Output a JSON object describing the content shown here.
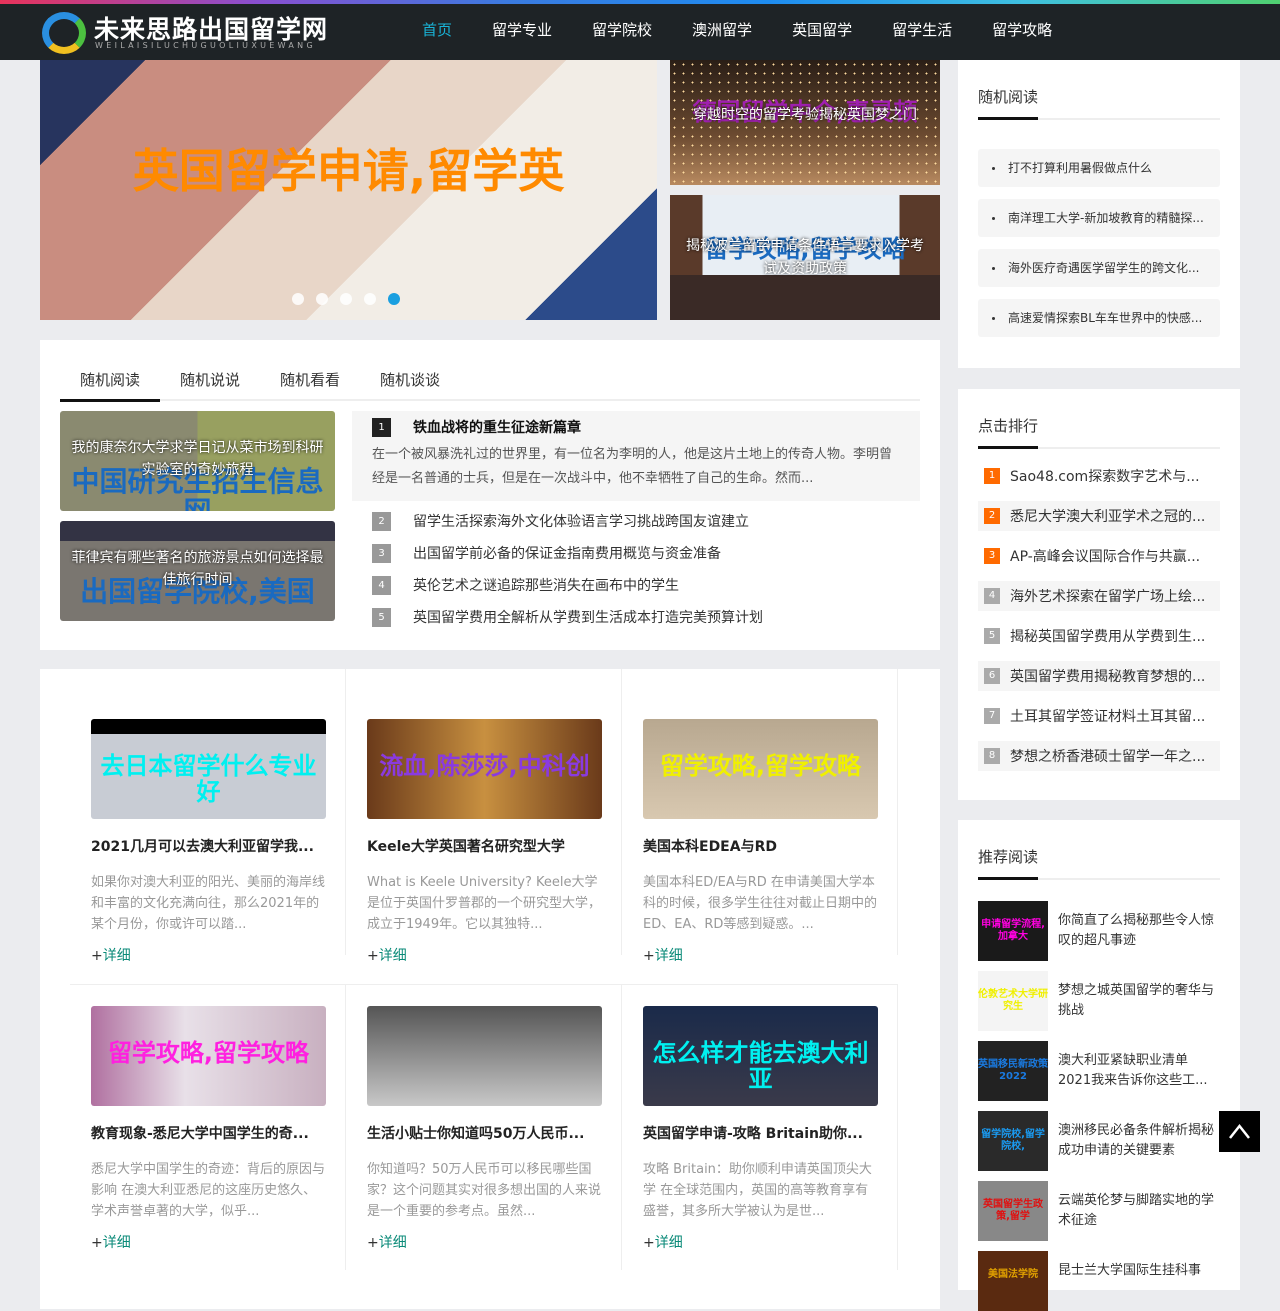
{
  "header": {
    "logo_title": "未来思路出国留学网",
    "logo_subtitle": "WEILAISILUCHUGUOLIUXUEWANG",
    "nav": [
      "首页",
      "留学专业",
      "留学院校",
      "澳洲留学",
      "英国留学",
      "留学生活",
      "留学攻略"
    ],
    "active_nav": "首页"
  },
  "slider": {
    "caption": "英国留学申请,留学英",
    "slide_count": 5,
    "active_slide": 5
  },
  "side_pics": [
    {
      "title": "穿越时空的留学考验揭秘英国梦之门",
      "overlay": "德国留学中介,惠灵顿"
    },
    {
      "title": "揭秘波兰留学申请条件语言要求入学考试及资助政策",
      "overlay": "留学攻略,留学攻略"
    }
  ],
  "tabs": {
    "items": [
      "随机阅读",
      "随机说说",
      "随机看看",
      "随机谈谈"
    ],
    "active": "随机阅读",
    "thumbs": [
      {
        "title": "我的康奈尔大学求学日记从菜市场到科研实验室的奇妙旅程",
        "overlay": "中国研究生招生信息网"
      },
      {
        "title": "菲律宾有哪些著名的旅游景点如何选择最佳旅行时间",
        "overlay": "出国留学院校,美国"
      }
    ],
    "list": [
      {
        "num": "1",
        "title": "铁血战将的重生征途新篇章",
        "desc": "在一个被风暴洗礼过的世界里，有一位名为李明的人，他是这片土地上的传奇人物。李明曾经是一名普通的士兵，但是在一次战斗中，他不幸牺牲了自己的生命。然而..."
      },
      {
        "num": "2",
        "title": "留学生活探索海外文化体验语言学习挑战跨国友谊建立"
      },
      {
        "num": "3",
        "title": "出国留学前必备的保证金指南费用概览与资金准备"
      },
      {
        "num": "4",
        "title": "英伦艺术之谜追踪那些消失在画布中的学生"
      },
      {
        "num": "5",
        "title": "英国留学费用全解析从学费到生活成本打造完美预算计划"
      }
    ]
  },
  "cards": {
    "more_label": "详细",
    "items": [
      {
        "title": "2021几月可以去澳大利亚留学我...",
        "desc": "如果你对澳大利亚的阳光、美丽的海岸线和丰富的文化充满向往，那么2021年的某个月份，你或许可以踏...",
        "overlay": "去日本留学什么专业好",
        "overlay_color": "#00f0f0"
      },
      {
        "title": "Keele大学英国著名研究型大学",
        "desc": "What is Keele University? Keele大学是位于英国什罗普郡的一个研究型大学，成立于1949年。它以其独特...",
        "overlay": "流血,陈莎莎,中科创",
        "overlay_color": "#8a3ae0"
      },
      {
        "title": "美国本科EDEA与RD",
        "desc": "美国本科ED/EA与RD 在申请美国大学本科的时候，很多学生往往对截止日期中的ED、EA、RD等感到疑惑。...",
        "overlay": "留学攻略,留学攻略",
        "overlay_color": "#f0f000"
      },
      {
        "title": "教育现象-悉尼大学中国学生的奇...",
        "desc": "悉尼大学中国学生的奇迹：背后的原因与影响 在澳大利亚悉尼的这座历史悠久、学术声誉卓著的大学，似乎...",
        "overlay": "留学攻略,留学攻略",
        "overlay_color": "#ff20e0"
      },
      {
        "title": "生活小贴士你知道吗50万人民币...",
        "desc": "你知道吗？50万人民币可以移民哪些国家？这个问题其实对很多想出国的人来说是一个重要的参考点。虽然...",
        "overlay": "",
        "overlay_color": "#ffffff"
      },
      {
        "title": "英国留学申请-攻略 Britain助你...",
        "desc": "攻略 Britain：助你顺利申请英国顶尖大学 在全球范围内，英国的高等教育享有盛誉，其多所大学被认为是世...",
        "overlay": "怎么样才能去澳大利亚",
        "overlay_color": "#00f0f0"
      }
    ]
  },
  "sidebar": {
    "random": {
      "title": "随机阅读",
      "items": [
        "打不打算利用暑假做点什么",
        "南洋理工大学-新加坡教育的精髓探...",
        "海外医疗奇遇医学留学生的跨文化...",
        "高速爱情探索BL车车世界中的快感..."
      ]
    },
    "ranking": {
      "title": "点击排行",
      "items": [
        {
          "num": "1",
          "title": "Sao48.com探索数字艺术与..."
        },
        {
          "num": "2",
          "title": "悉尼大学澳大利亚学术之冠的..."
        },
        {
          "num": "3",
          "title": "AP-高峰会议国际合作与共赢..."
        },
        {
          "num": "4",
          "title": "海外艺术探索在留学广场上绘..."
        },
        {
          "num": "5",
          "title": "揭秘英国留学费用从学费到生..."
        },
        {
          "num": "6",
          "title": "英国留学费用揭秘教育梦想的..."
        },
        {
          "num": "7",
          "title": "土耳其留学签证材料土耳其留..."
        },
        {
          "num": "8",
          "title": "梦想之桥香港硕士留学一年之..."
        }
      ]
    },
    "recommend": {
      "title": "推荐阅读",
      "items": [
        {
          "title": "你简直了么揭秘那些令人惊叹的超凡事迹",
          "overlay": "申请留学流程,加拿大",
          "overlay_color": "#ff00e0",
          "bg": "#1a1a1a"
        },
        {
          "title": "梦想之城英国留学的奢华与挑战",
          "overlay": "伦敦艺术大学研究生",
          "overlay_color": "#f0f000",
          "bg": "#f4f4f4"
        },
        {
          "title": "澳大利亚紧缺职业清单2021我来告诉你这些工...",
          "overlay": "英国移民新政策2022",
          "overlay_color": "#1a7ae0",
          "bg": "#222"
        },
        {
          "title": "澳洲移民必备条件解析揭秘成功申请的关键要素",
          "overlay": "留学院校,留学院校,",
          "overlay_color": "#1a9af0",
          "bg": "#2a2a2a"
        },
        {
          "title": "云端英伦梦与脚踏实地的学术征途",
          "overlay": "英国留学生政策,留学",
          "overlay_color": "#e01010",
          "bg": "#888"
        },
        {
          "title": "昆士兰大学国际生挂科事",
          "overlay": "美国法学院",
          "overlay_color": "#e0a000",
          "bg": "#5a2a10"
        }
      ]
    }
  },
  "back_to_top": "^"
}
